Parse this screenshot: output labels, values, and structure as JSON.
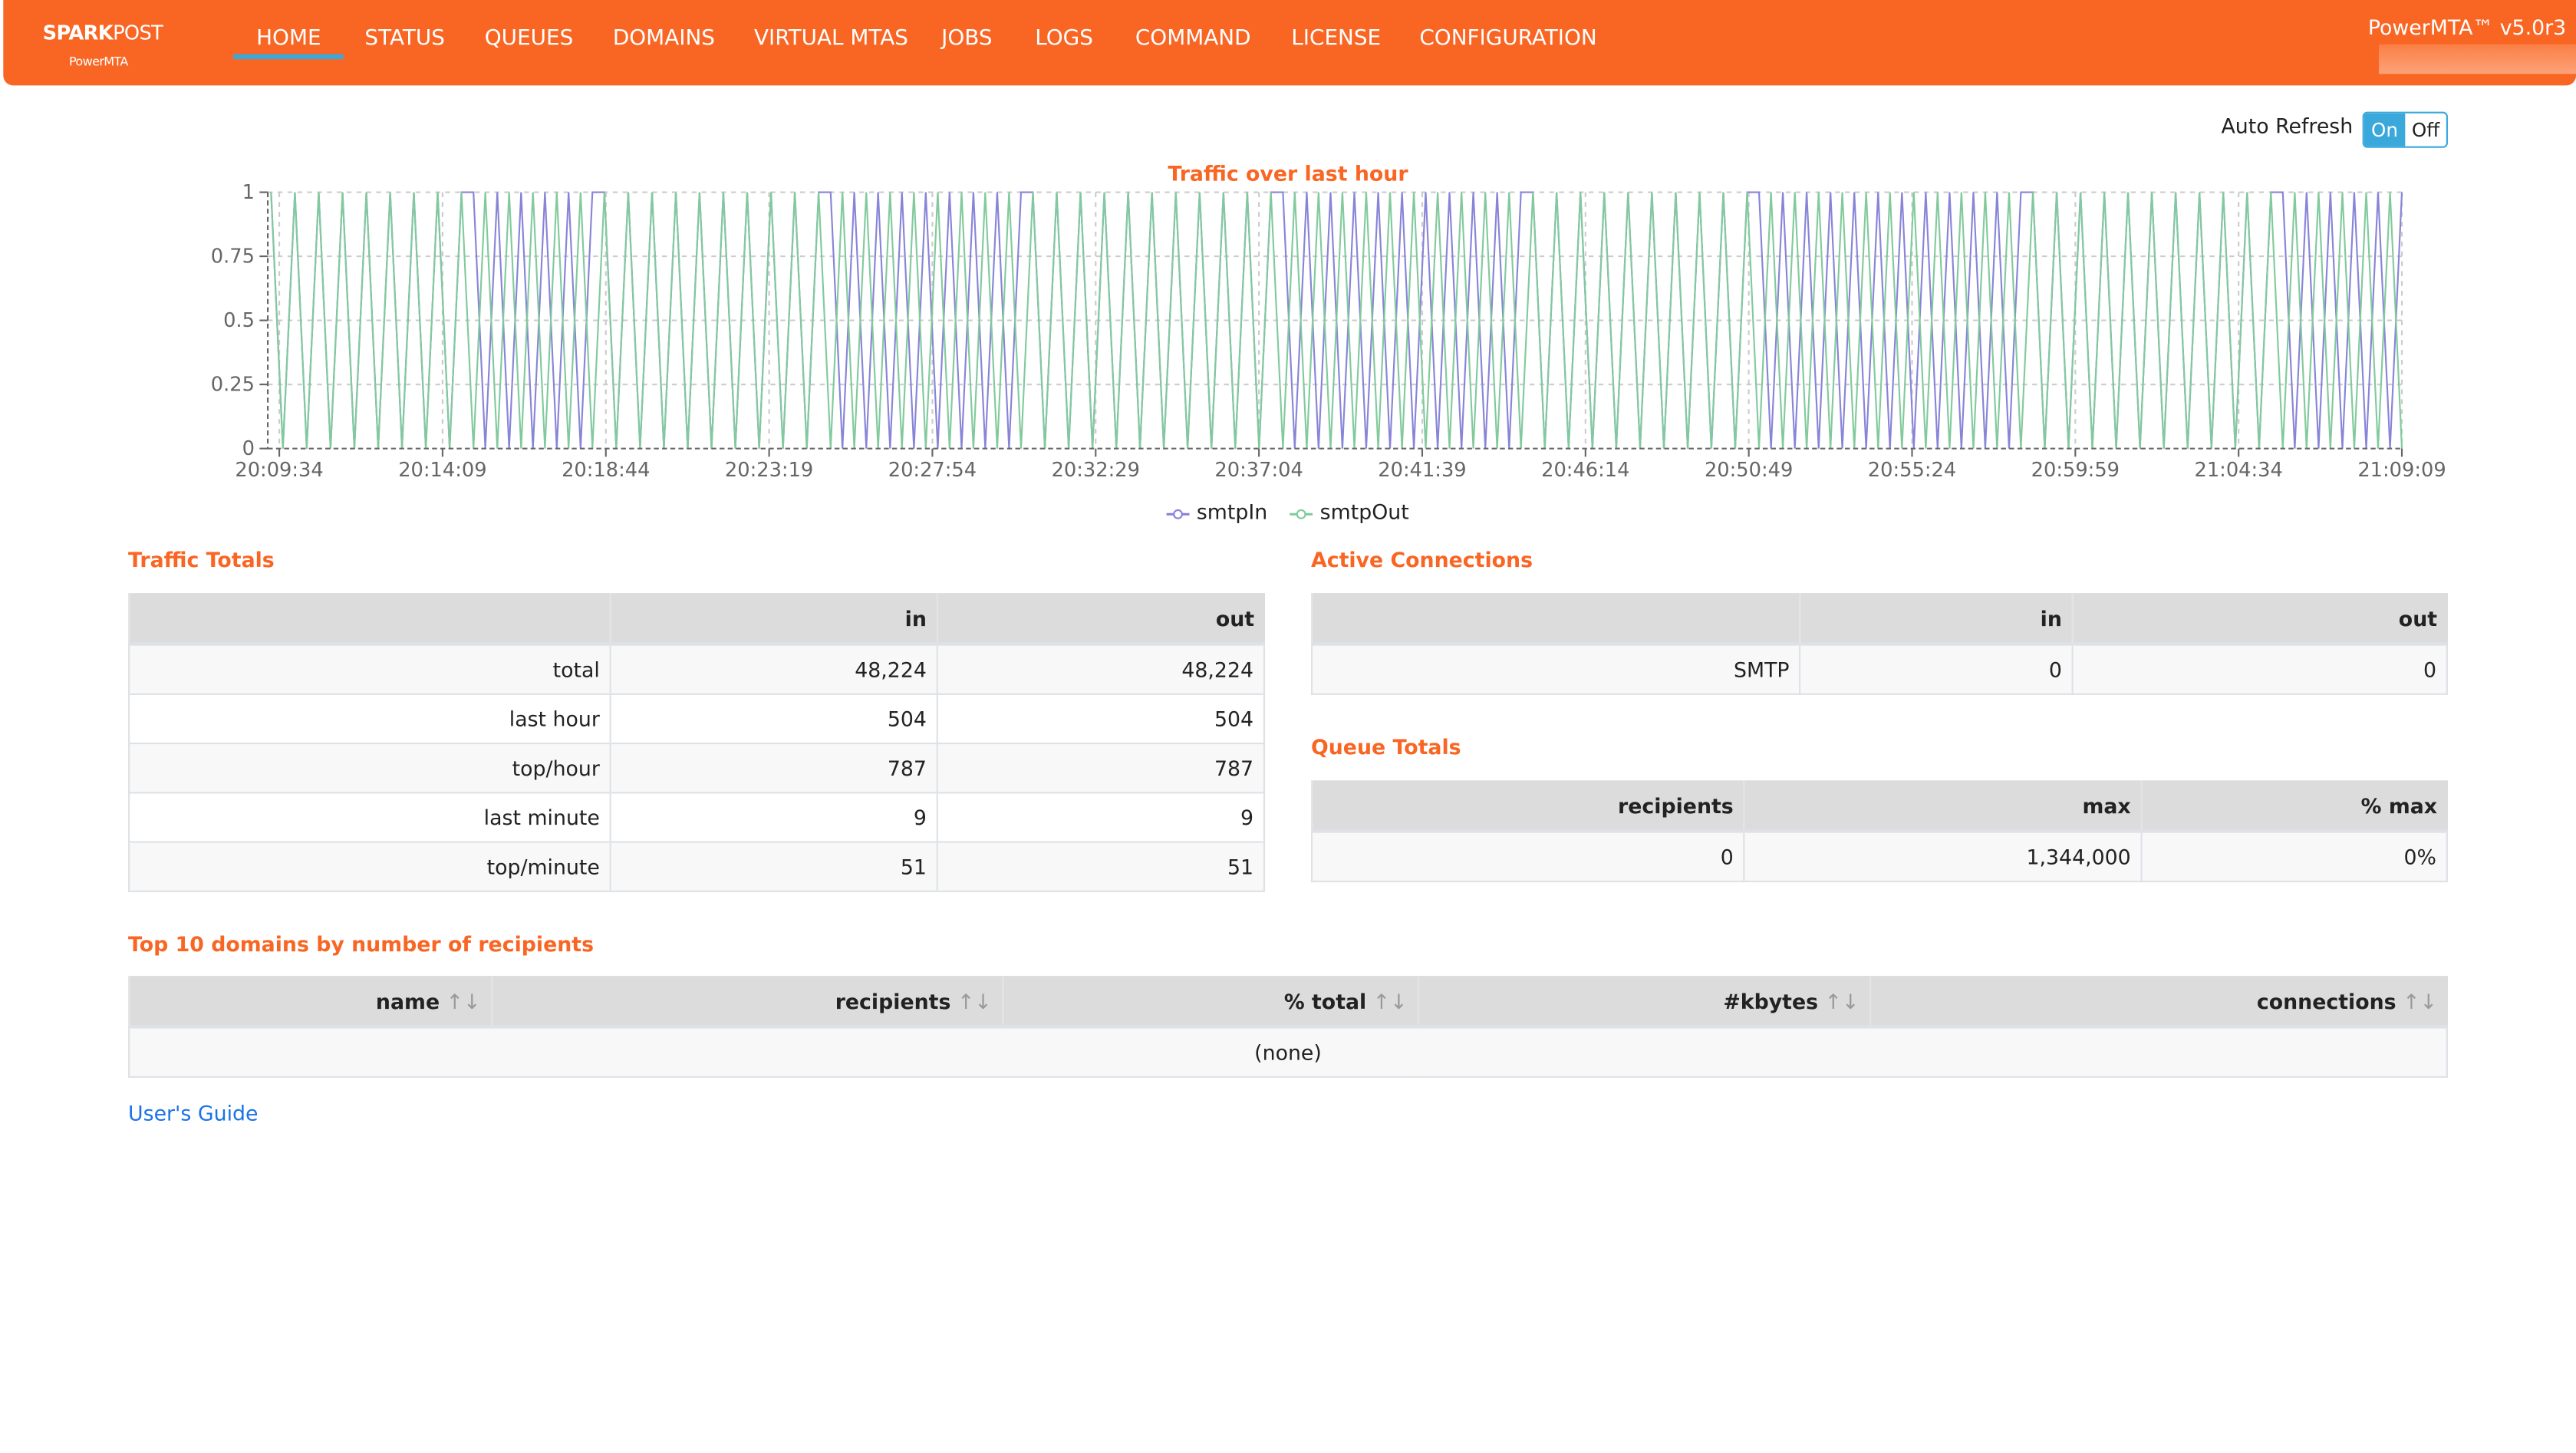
{
  "header": {
    "brand": "SPARKPOST",
    "brand_first": "SPARK",
    "brand_second": "POST",
    "brand_sub": "PowerMTA",
    "version": "PowerMTA™ v5.0r3",
    "nav": [
      "HOME",
      "STATUS",
      "QUEUES",
      "DOMAINS",
      "VIRTUAL MTAS",
      "JOBS",
      "LOGS",
      "COMMAND",
      "LICENSE",
      "CONFIGURATION"
    ],
    "active_nav": "HOME",
    "accent": "#F96624",
    "active_underline": "#3AA8DB"
  },
  "auto_refresh": {
    "label": "Auto Refresh",
    "on": "On",
    "off": "Off",
    "selected": "On"
  },
  "chart_data": {
    "type": "line",
    "title": "Traffic over last hour",
    "x_ticks": [
      "20:09:34",
      "20:14:09",
      "20:18:44",
      "20:23:19",
      "20:27:54",
      "20:32:29",
      "20:37:04",
      "20:41:39",
      "20:46:14",
      "20:50:49",
      "20:55:24",
      "20:59:59",
      "21:04:34",
      "21:09:09"
    ],
    "y_ticks": [
      "0",
      "0.25",
      "0.5",
      "0.75",
      "1"
    ],
    "ylim": [
      0,
      1
    ],
    "grid": true,
    "legend": "bottom",
    "series": [
      {
        "name": "smtpIn",
        "color": "#8884d8",
        "values": [
          1,
          0,
          1,
          0,
          1,
          0,
          1,
          0,
          1,
          0,
          1,
          0,
          1,
          0,
          1,
          0,
          1,
          1,
          0,
          1,
          0,
          1,
          0,
          1,
          0,
          1,
          0,
          1,
          1,
          0,
          1,
          0,
          1,
          0,
          1,
          0,
          1,
          0,
          1,
          0,
          1,
          0,
          1,
          0,
          1,
          0,
          1,
          1,
          0,
          1,
          0,
          1,
          0,
          1,
          0,
          1,
          0,
          1,
          0,
          1,
          0,
          1,
          0,
          1,
          1,
          0,
          1,
          0,
          1,
          0,
          1,
          0,
          1,
          0,
          1,
          0,
          1,
          0,
          1,
          0,
          1,
          0,
          1,
          0,
          1,
          1,
          0,
          1,
          0,
          1,
          0,
          1,
          0,
          1,
          0,
          1,
          0,
          1,
          0,
          1,
          0,
          1,
          0,
          1,
          0,
          1,
          1,
          0,
          1,
          0,
          1,
          0,
          1,
          0,
          1,
          0,
          1,
          0,
          1,
          0,
          1,
          0,
          1,
          0,
          1,
          1,
          0,
          1,
          0,
          1,
          0,
          1,
          0,
          1,
          0,
          1,
          0,
          1,
          0,
          1,
          0,
          1,
          0,
          1,
          0,
          1,
          0,
          1,
          1,
          0,
          1,
          0,
          1,
          0,
          1,
          0,
          1,
          0,
          1,
          0,
          1,
          0,
          1,
          0,
          1,
          0,
          1,
          0,
          1,
          1,
          0,
          1,
          0,
          1,
          0,
          1,
          0,
          1,
          0,
          1
        ]
      },
      {
        "name": "smtpOut",
        "color": "#82ca9d",
        "values": [
          1,
          0,
          1,
          0,
          1,
          0,
          1,
          0,
          1,
          0,
          1,
          0,
          1,
          0,
          1,
          0,
          1,
          0,
          1,
          0,
          1,
          0,
          1,
          0,
          1,
          0,
          1,
          0,
          1,
          0,
          1,
          0,
          1,
          0,
          1,
          0,
          1,
          0,
          1,
          0,
          1,
          0,
          1,
          0,
          1,
          0,
          1,
          0,
          1,
          0,
          1,
          0,
          1,
          0,
          1,
          0,
          1,
          0,
          1,
          0,
          1,
          0,
          1,
          0,
          1,
          0,
          1,
          0,
          1,
          0,
          1,
          0,
          1,
          0,
          1,
          0,
          1,
          0,
          1,
          0,
          1,
          0,
          1,
          0,
          1,
          0,
          1,
          0,
          1,
          0,
          1,
          0,
          1,
          0,
          1,
          0,
          1,
          0,
          1,
          0,
          1,
          0,
          1,
          0,
          1,
          0,
          1,
          0,
          1,
          0,
          1,
          0,
          1,
          0,
          1,
          0,
          1,
          0,
          1,
          0,
          1,
          0,
          1,
          0,
          1,
          0,
          1,
          0,
          1,
          0,
          1,
          0,
          1,
          0,
          1,
          0,
          1,
          0,
          1,
          0,
          1,
          0,
          1,
          0,
          1,
          0,
          1,
          0,
          1,
          0,
          1,
          0,
          1,
          0,
          1,
          0,
          1,
          0,
          1,
          0,
          1,
          0,
          1,
          0,
          1,
          0,
          1,
          0,
          1,
          0,
          1,
          0,
          1,
          0,
          1,
          0,
          1,
          0,
          1,
          0
        ]
      }
    ]
  },
  "traffic_totals": {
    "title": "Traffic Totals",
    "columns": [
      "",
      "in",
      "out"
    ],
    "rows": [
      [
        "total",
        "48,224",
        "48,224"
      ],
      [
        "last hour",
        "504",
        "504"
      ],
      [
        "top/hour",
        "787",
        "787"
      ],
      [
        "last minute",
        "9",
        "9"
      ],
      [
        "top/minute",
        "51",
        "51"
      ]
    ]
  },
  "active_connections": {
    "title": "Active Connections",
    "columns": [
      "",
      "in",
      "out"
    ],
    "rows": [
      [
        "SMTP",
        "0",
        "0"
      ]
    ]
  },
  "queue_totals": {
    "title": "Queue Totals",
    "columns": [
      "recipients",
      "max",
      "% max"
    ],
    "rows": [
      [
        "0",
        "1,344,000",
        "0%"
      ]
    ]
  },
  "top_domains": {
    "title": "Top 10 domains by number of recipients",
    "columns": [
      "name",
      "recipients",
      "% total",
      "#kbytes",
      "connections"
    ],
    "sort_icon": "↑↓",
    "empty": "(none)"
  },
  "footer": {
    "users_guide": "User's Guide"
  }
}
